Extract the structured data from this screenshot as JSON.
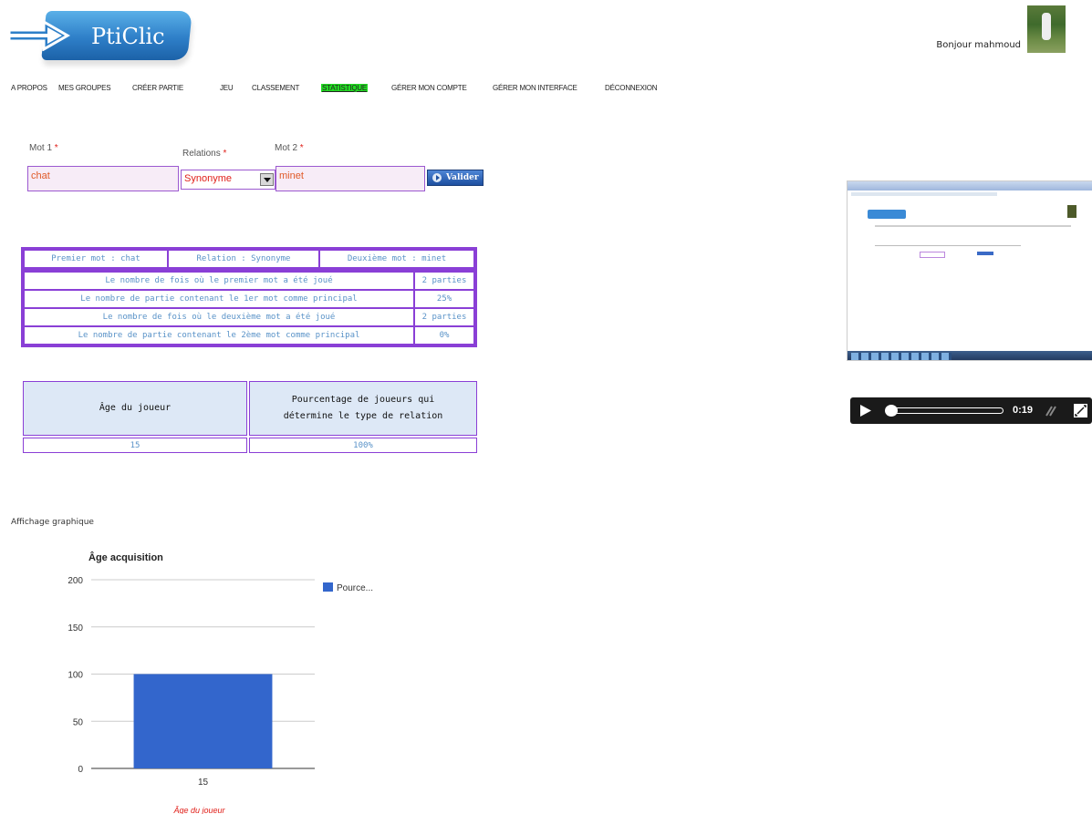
{
  "header": {
    "logo_text": "PtiClic",
    "greeting": "Bonjour mahmoud"
  },
  "nav": {
    "items": [
      {
        "label": "A PROPOS"
      },
      {
        "label": "MES GROUPES"
      },
      {
        "label": "CRÉER PARTIE"
      },
      {
        "label": "JEU"
      },
      {
        "label": "CLASSEMENT"
      },
      {
        "label": "STATISTIQUE"
      },
      {
        "label": "GÉRER MON COMPTE"
      },
      {
        "label": "GÉRER MON INTERFACE"
      },
      {
        "label": "DÉCONNEXION"
      }
    ],
    "active": "STATISTIQUE"
  },
  "form": {
    "mot1_label": "Mot 1",
    "relations_label": "Relations",
    "mot2_label": "Mot 2",
    "required_mark": "*",
    "mot1_value": "chat",
    "relation_value": "Synonyme",
    "mot2_value": "minet",
    "submit_label": "Valider"
  },
  "summary": {
    "header": [
      "Premier mot : chat",
      "Relation : Synonyme",
      "Deuxième mot : minet"
    ],
    "rows": [
      {
        "label": "Le nombre de fois où le premier mot a été joué",
        "value": "2 parties"
      },
      {
        "label": "Le nombre de partie contenant le 1er mot comme principal",
        "value": "25%"
      },
      {
        "label": "Le nombre de fois où le deuxième mot a été joué",
        "value": "2 parties"
      },
      {
        "label": "Le nombre de partie contenant le 2ème mot comme principal",
        "value": "0%"
      }
    ]
  },
  "age_table": {
    "col1": "Âge du joueur",
    "col2_line1": "Pourcentage de joueurs qui",
    "col2_line2": "détermine le type de relation",
    "row": {
      "age": "15",
      "pct": "100%"
    }
  },
  "chart_section_title": "Affichage graphique",
  "chart_data": {
    "type": "bar",
    "title": "Âge acquisition",
    "xlabel": "Âge du joueur",
    "ylabel": "",
    "categories": [
      "15"
    ],
    "series": [
      {
        "name": "Pource...",
        "values": [
          100
        ]
      }
    ],
    "ylim": [
      0,
      200
    ],
    "yticks": [
      0,
      50,
      100,
      150,
      200
    ],
    "grid": true,
    "legend": "right",
    "bar_color": "#3366cc"
  },
  "video": {
    "time": "0:19"
  },
  "colors": {
    "border": "#8a3fd6",
    "link_blue": "#5a93c8",
    "active_nav": "#22dd22",
    "required": "#e0201a"
  }
}
